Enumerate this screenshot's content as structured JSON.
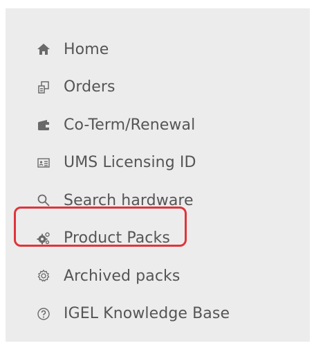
{
  "menu": {
    "items": [
      {
        "label": "Home",
        "icon": "home-icon"
      },
      {
        "label": "Orders",
        "icon": "orders-icon"
      },
      {
        "label": "Co-Term/Renewal",
        "icon": "wallet-icon"
      },
      {
        "label": "UMS Licensing ID",
        "icon": "id-card-icon"
      },
      {
        "label": "Search hardware",
        "icon": "search-icon"
      },
      {
        "label": "Product Packs",
        "icon": "gears-icon"
      },
      {
        "label": "Archived packs",
        "icon": "gear-icon"
      },
      {
        "label": "IGEL Knowledge Base",
        "icon": "help-icon"
      }
    ],
    "highlighted_item": "Product Packs"
  },
  "colors": {
    "panel_background": "#ececec",
    "text": "#555555",
    "icon": "#6a6a6a",
    "highlight_border": "#e0343a"
  }
}
